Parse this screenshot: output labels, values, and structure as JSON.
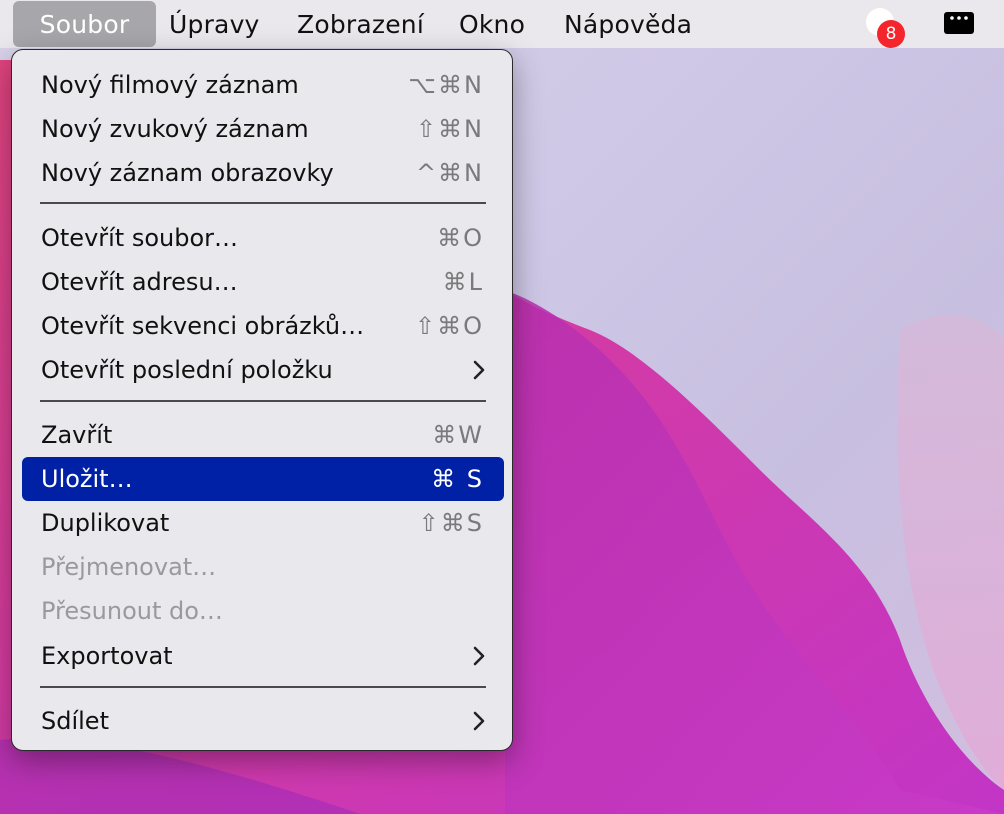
{
  "menubar": {
    "items": [
      "Soubor",
      "Úpravy",
      "Zobrazení",
      "Okno",
      "Nápověda"
    ],
    "notification_count": "8"
  },
  "icons": {
    "notification": "notification-bubble-icon",
    "control": "control-strip-icon",
    "submenu": "chevron-right-icon"
  },
  "colors": {
    "highlight": "#0021a6",
    "badge": "#f4252b",
    "menu_background": "#e9e8ec"
  },
  "file_menu": {
    "groups": [
      [
        {
          "label": "Nový filmový záznam",
          "shortcut": "⌥⌘N"
        },
        {
          "label": "Nový zvukový záznam",
          "shortcut": "⇧⌘N"
        },
        {
          "label": "Nový záznam obrazovky",
          "shortcut": "^⌘N"
        }
      ],
      [
        {
          "label": "Otevřít soubor…",
          "shortcut": "⌘O"
        },
        {
          "label": "Otevřít adresu…",
          "shortcut": "⌘L"
        },
        {
          "label": "Otevřít sekvenci obrázků…",
          "shortcut": "⇧⌘O"
        },
        {
          "label": "Otevřít poslední položku",
          "shortcut": ""
        }
      ],
      [
        {
          "label": "Zavřít",
          "shortcut": "⌘W"
        },
        {
          "label": "Uložit…",
          "shortcut": "⌘ S"
        },
        {
          "label": "Duplikovat",
          "shortcut": "⇧⌘S"
        },
        {
          "label": "Přejmenovat…",
          "shortcut": ""
        },
        {
          "label": "Přesunout do…",
          "shortcut": ""
        },
        {
          "label": "Exportovat",
          "shortcut": ""
        }
      ],
      [
        {
          "label": "Sdílet",
          "shortcut": ""
        }
      ]
    ]
  }
}
